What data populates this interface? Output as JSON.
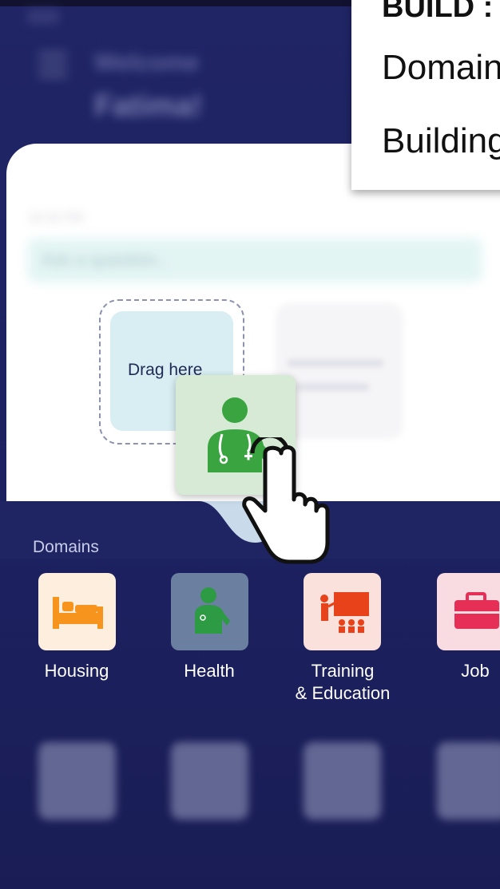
{
  "header": {
    "welcome": "Welcome",
    "username": "Fatima!"
  },
  "chat": {
    "time": "03:32 PM",
    "ask_placeholder": "Ask a question...",
    "drop_label": "Drag here"
  },
  "domains": {
    "label": "Domains",
    "items": [
      {
        "label": "Housing",
        "icon": "bed-icon",
        "bg": "#fdeedd",
        "fg": "#f7941d"
      },
      {
        "label": "Health",
        "icon": "doctor-icon",
        "bg": "#6b7fa0",
        "fg": "#2d9a44"
      },
      {
        "label": "Training\n& Education",
        "label_line1": "Training",
        "label_line2": "& Education",
        "icon": "classroom-icon",
        "bg": "#fbe1dc",
        "fg": "#e8421a"
      },
      {
        "label": "Job",
        "icon": "briefcase-icon",
        "bg": "#f9dbe2",
        "fg": "#e62f57"
      }
    ]
  },
  "dragged_tile": {
    "icon": "doctor-icon",
    "bg": "#d6ead6",
    "fg": "#3aa540"
  },
  "overlay": {
    "title": "BUILD :",
    "line1": "Domain",
    "line2": "Building"
  }
}
